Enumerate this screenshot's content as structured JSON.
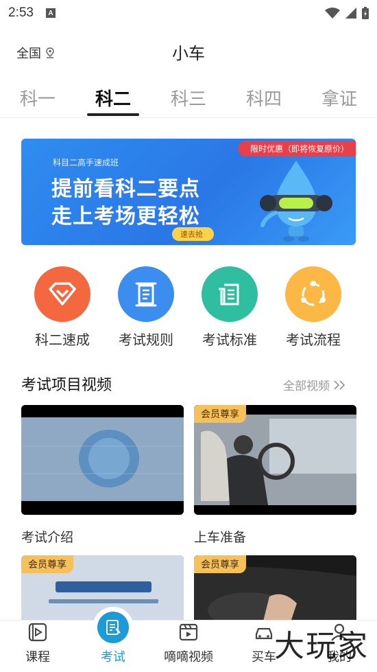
{
  "status_bar": {
    "time": "2:53",
    "notification_glyph": "A"
  },
  "header": {
    "region": "全国",
    "title": "小车"
  },
  "tabs": [
    {
      "label": "科一",
      "active": false
    },
    {
      "label": "科二",
      "active": true
    },
    {
      "label": "科三",
      "active": false
    },
    {
      "label": "科四",
      "active": false
    },
    {
      "label": "拿证",
      "active": false
    }
  ],
  "banner": {
    "kicker": "科目二高手速成班",
    "line1": "提前看科二要点",
    "line2": "走上考场更轻松",
    "badge": "限时优惠（即将恢复原价）",
    "cta": "速去抢"
  },
  "features": [
    {
      "label": "科二速成",
      "icon": "diamond-icon",
      "color": "#f4683f"
    },
    {
      "label": "考试规则",
      "icon": "scroll-icon",
      "color": "#3b8ef0"
    },
    {
      "label": "考试标准",
      "icon": "document-icon",
      "color": "#2fbfa0"
    },
    {
      "label": "考试流程",
      "icon": "cycle-icon",
      "color": "#fbb845"
    }
  ],
  "videos_section": {
    "title": "考试项目视频",
    "more": "全部视频"
  },
  "videos": [
    {
      "title": "考试介绍",
      "vip": ""
    },
    {
      "title": "上车准备",
      "vip": "会员尊享"
    },
    {
      "title": "",
      "vip": "会员尊享"
    },
    {
      "title": "",
      "vip": "会员尊享"
    }
  ],
  "bottom_nav": [
    {
      "label": "课程",
      "icon": "course-icon"
    },
    {
      "label": "考试",
      "icon": "exam-icon",
      "active": true
    },
    {
      "label": "嘀嘀视频",
      "icon": "video-icon"
    },
    {
      "label": "买车",
      "icon": "car-icon"
    },
    {
      "label": "我的",
      "icon": "profile-icon"
    }
  ],
  "watermark": "大玩家",
  "colors": {
    "accent": "#1f9ad8",
    "banner_blue": "#2f8df0",
    "vip_gold": "#f5c15a"
  }
}
